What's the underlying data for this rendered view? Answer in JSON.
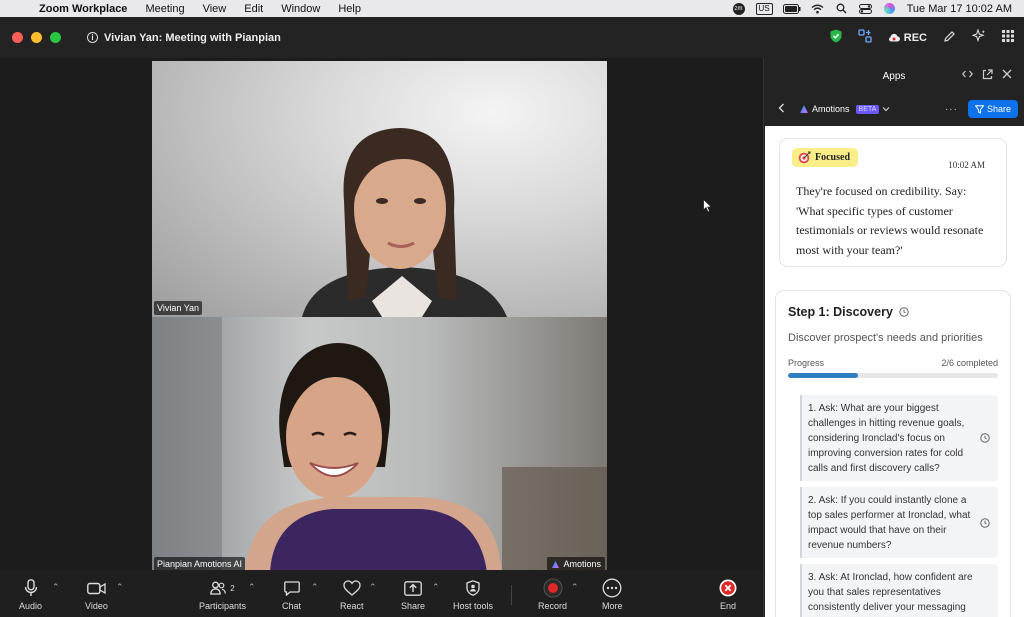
{
  "menubar": {
    "app": "Zoom Workplace",
    "menus": [
      "Meeting",
      "View",
      "Edit",
      "Window",
      "Help"
    ],
    "status": {
      "zm": "zm",
      "input_source": "US",
      "datetime": "Tue Mar 17  10:02 AM"
    }
  },
  "window": {
    "title": "Vivian Yan: Meeting with Pianpian",
    "rec_label": "REC"
  },
  "videos": [
    {
      "name": "Vivian Yan"
    },
    {
      "name": "Pianpian Amotions AI",
      "app_badge": "Amotions"
    }
  ],
  "toolbar": {
    "audio": "Audio",
    "video": "Video",
    "participants": "Participants",
    "participants_count": "2",
    "chat": "Chat",
    "react": "React",
    "share": "Share",
    "host_tools": "Host tools",
    "record": "Record",
    "more": "More",
    "end": "End"
  },
  "panel": {
    "header": "Apps",
    "app_name": "Amotions",
    "beta": "BETA",
    "share": "Share",
    "focus": {
      "badge": "Focused",
      "time": "10:02 AM",
      "text": "They're focused on credibility. Say: 'What specific types of customer testimonials or reviews would resonate most with your team?'"
    },
    "step": {
      "title": "Step 1: Discovery",
      "description": "Discover prospect's needs and priorities",
      "progress_label": "Progress",
      "progress_text": "2/6 completed",
      "progress_fraction": 0.333,
      "questions": [
        "1. Ask: What are your biggest challenges in hitting revenue goals, considering Ironclad's focus on improving conversion rates for cold calls and first discovery calls?",
        "2. Ask: If you could instantly clone a top sales performer at Ironclad, what impact would that have on their revenue numbers?",
        "3. Ask: At Ironclad, how confident are you that sales representatives consistently deliver your messaging"
      ]
    }
  },
  "colors": {
    "share_blue": "#0e72ed",
    "record_red": "#e02828",
    "focus_yellow": "#f9ee88",
    "progress_blue": "#2f7ec2",
    "shield_green": "#2bb84a"
  }
}
